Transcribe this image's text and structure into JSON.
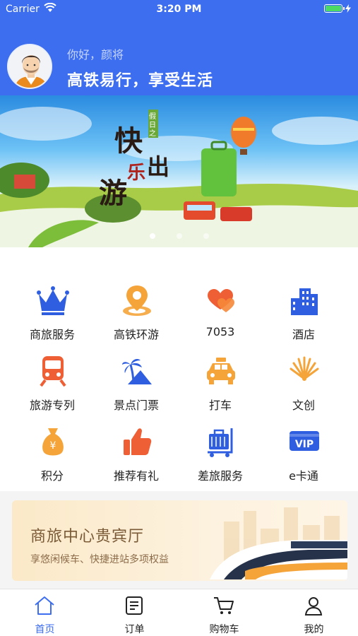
{
  "status_bar": {
    "carrier": "Carrier",
    "time": "3:20 PM"
  },
  "header": {
    "greeting": "你好，颜将",
    "slogan": "高铁易行，享受生活"
  },
  "banner": {
    "slide_count": 3,
    "active_index": 0
  },
  "services": [
    {
      "label": "商旅服务",
      "icon": "crown-icon"
    },
    {
      "label": "高铁环游",
      "icon": "location-pin-icon"
    },
    {
      "label": "7053",
      "icon": "hearts-icon"
    },
    {
      "label": "酒店",
      "icon": "hotel-building-icon"
    },
    {
      "label": "旅游专列",
      "icon": "train-icon"
    },
    {
      "label": "景点门票",
      "icon": "palm-tree-icon"
    },
    {
      "label": "打车",
      "icon": "taxi-icon"
    },
    {
      "label": "文创",
      "icon": "fan-icon"
    },
    {
      "label": "积分",
      "icon": "money-bag-icon"
    },
    {
      "label": "推荐有礼",
      "icon": "thumbs-up-icon"
    },
    {
      "label": "差旅服务",
      "icon": "luggage-cart-icon"
    },
    {
      "label": "e卡通",
      "icon": "vip-card-icon"
    }
  ],
  "lounge": {
    "title": "商旅中心贵宾厅",
    "subtitle": "享悠闲候车、快捷进站多项权益"
  },
  "tabs": [
    {
      "label": "首页",
      "icon": "home-icon",
      "active": true
    },
    {
      "label": "订单",
      "icon": "order-icon",
      "active": false
    },
    {
      "label": "购物车",
      "icon": "cart-icon",
      "active": false
    },
    {
      "label": "我的",
      "icon": "profile-icon",
      "active": false
    }
  ],
  "colors": {
    "primary": "#3d6ef0",
    "orange": "#f5a43a",
    "red_orange": "#ef5f35"
  }
}
